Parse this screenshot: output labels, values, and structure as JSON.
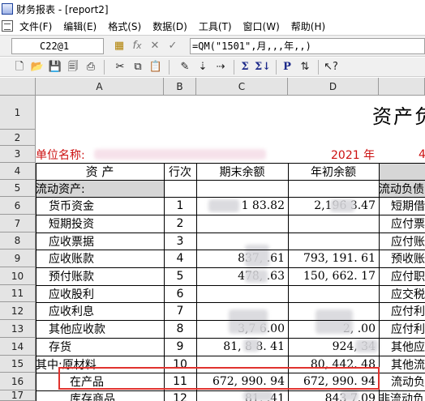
{
  "window": {
    "title": "财务报表 - [report2]"
  },
  "menu": {
    "items": [
      "文件(F)",
      "编辑(E)",
      "格式(S)",
      "数据(D)",
      "工具(T)",
      "窗口(W)",
      "帮助(H)"
    ]
  },
  "formula_bar": {
    "cell_ref": "C22@1",
    "formula": "=QM(\"1501\",月,,,年,,)"
  },
  "sheet": {
    "columns": [
      "A",
      "B",
      "C",
      "D"
    ],
    "rows": [
      "1",
      "2",
      "3",
      "4",
      "5",
      "6",
      "7",
      "8",
      "9",
      "10",
      "11",
      "12",
      "13",
      "14",
      "15",
      "16",
      "17"
    ],
    "title": "资产负",
    "unit_label": "单位名称:",
    "year_label": "2021 年",
    "month_partial": "4",
    "headers": {
      "asset": "资    产",
      "line": "行次",
      "end_balance": "期末余额",
      "begin_balance": "年初余额",
      "liab_partial": "流动负债"
    },
    "body": [
      {
        "name": "流动资产:",
        "line": "",
        "end": "",
        "begin": "",
        "right": "流动负债"
      },
      {
        "name": "货币资金",
        "line": "1",
        "end": "1      83.82",
        "begin": "2,196      3.47",
        "right": "短期借"
      },
      {
        "name": "短期投资",
        "line": "2",
        "end": "",
        "begin": "",
        "right": "应付票"
      },
      {
        "name": "应收票据",
        "line": "3",
        "end": "",
        "begin": "",
        "right": "应付账"
      },
      {
        "name": "应收账款",
        "line": "4",
        "end": "837,      .61",
        "begin": "793, 191. 61",
        "right": "预收账"
      },
      {
        "name": "预付账款",
        "line": "5",
        "end": "478,      .63",
        "begin": "150, 662. 17",
        "right": "应付职"
      },
      {
        "name": "应收股利",
        "line": "6",
        "end": "",
        "begin": "",
        "right": "应交税"
      },
      {
        "name": "应收利息",
        "line": "7",
        "end": "",
        "begin": "",
        "right": "应付利"
      },
      {
        "name": "其他应收款",
        "line": "8",
        "end": "3,7      6.00",
        "begin": "2,      .00",
        "right": "应付利"
      },
      {
        "name": "存货",
        "line": "9",
        "end": "81, 8  8. 41",
        "begin": "924, 34",
        "right": "其他应"
      },
      {
        "name": "其中:原材料",
        "line": "10",
        "end": "",
        "begin": "80, 442. 48",
        "right": "其他流"
      },
      {
        "name": "在产品",
        "line": "11",
        "end": "672, 990. 94",
        "begin": "672, 990. 94",
        "right": "流动负"
      },
      {
        "name": "库存商品",
        "line": "12",
        "end": "81,      .41",
        "begin": "843      7.09",
        "right": "非流动负"
      }
    ]
  },
  "colors": {
    "accent_red": "#cc1111",
    "highlight": "#e0322e",
    "header_gray": "#e4e4e4"
  }
}
